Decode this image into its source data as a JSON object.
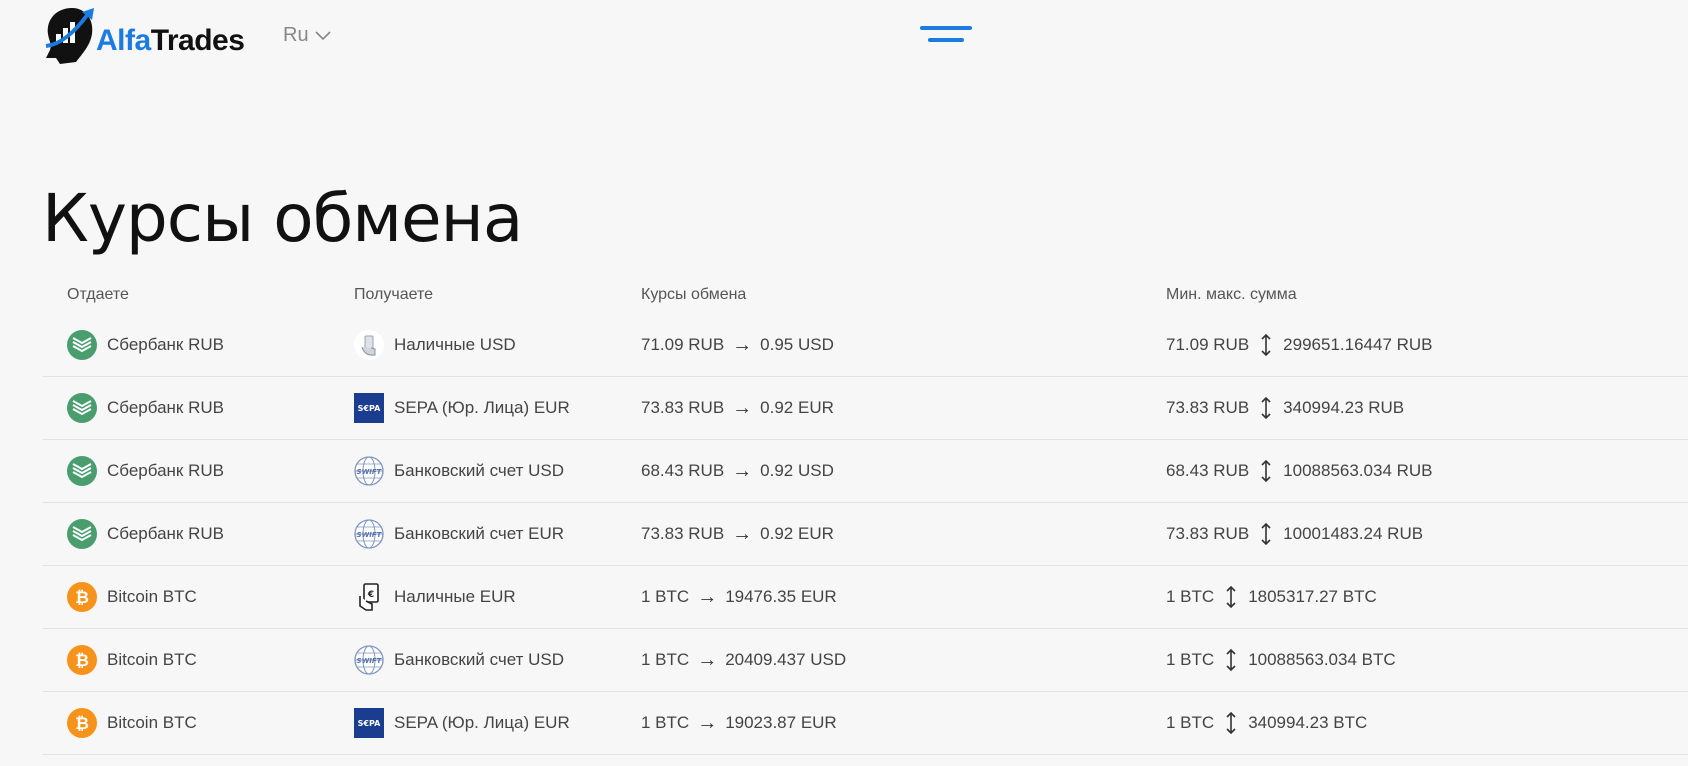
{
  "header": {
    "logo": {
      "part1": "Alfa",
      "part2": "Trades"
    },
    "language": "Ru"
  },
  "page_title": "Курсы обмена",
  "table": {
    "columns": [
      "Отдаете",
      "Получаете",
      "Курсы обмена",
      "Мин. макс. сумма"
    ],
    "rows": [
      {
        "give": "Сбербанк RUB",
        "give_icon": "sberbank-icon",
        "get": "Наличные USD",
        "get_icon": "cash-hand-icon",
        "rate_from": "71.09 RUB",
        "rate_to": "0.95 USD",
        "min": "71.09 RUB",
        "max": "299651.16447 RUB"
      },
      {
        "give": "Сбербанк RUB",
        "give_icon": "sberbank-icon",
        "get": "SEPA (Юр. Лица) EUR",
        "get_icon": "sepa-icon",
        "rate_from": "73.83 RUB",
        "rate_to": "0.92 EUR",
        "min": "73.83 RUB",
        "max": "340994.23 RUB"
      },
      {
        "give": "Сбербанк RUB",
        "give_icon": "sberbank-icon",
        "get": "Банковский счет USD",
        "get_icon": "swift-icon",
        "rate_from": "68.43 RUB",
        "rate_to": "0.92 USD",
        "min": "68.43 RUB",
        "max": "10088563.034 RUB"
      },
      {
        "give": "Сбербанк RUB",
        "give_icon": "sberbank-icon",
        "get": "Банковский счет EUR",
        "get_icon": "swift-icon",
        "rate_from": "73.83 RUB",
        "rate_to": "0.92 EUR",
        "min": "73.83 RUB",
        "max": "10001483.24 RUB"
      },
      {
        "give": "Bitcoin BTC",
        "give_icon": "bitcoin-icon",
        "get": "Наличные EUR",
        "get_icon": "cash-euro-icon",
        "rate_from": "1 BTC",
        "rate_to": "19476.35 EUR",
        "min": "1 BTC",
        "max": "1805317.27 BTC"
      },
      {
        "give": "Bitcoin BTC",
        "give_icon": "bitcoin-icon",
        "get": "Банковский счет USD",
        "get_icon": "swift-icon",
        "rate_from": "1 BTC",
        "rate_to": "20409.437 USD",
        "min": "1 BTC",
        "max": "10088563.034 BTC"
      },
      {
        "give": "Bitcoin BTC",
        "give_icon": "bitcoin-icon",
        "get": "SEPA (Юр. Лица) EUR",
        "get_icon": "sepa-icon",
        "rate_from": "1 BTC",
        "rate_to": "19023.87 EUR",
        "min": "1 BTC",
        "max": "340994.23 BTC"
      }
    ]
  },
  "colors": {
    "accent": "#1b7be0",
    "sber": "#4a9e6e",
    "bitcoin": "#f7931a",
    "sepa": "#1a3d8f"
  }
}
